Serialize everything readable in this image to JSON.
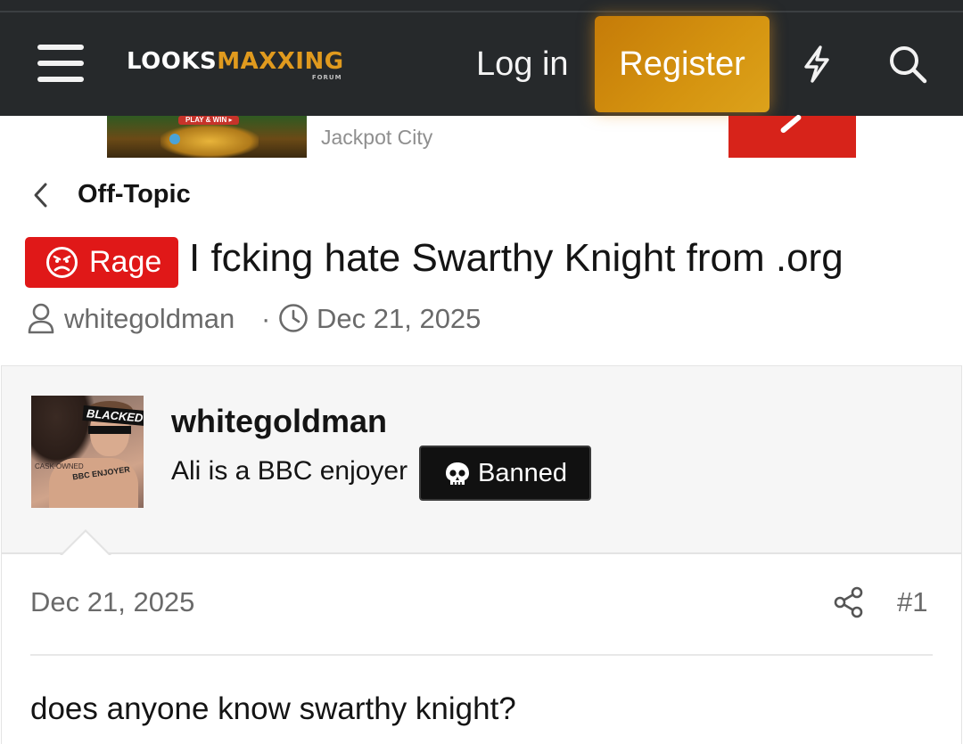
{
  "header": {
    "logo_main_a": "LOOKS",
    "logo_main_b": "MAXXING",
    "logo_sub": "FORUM",
    "login_label": "Log in",
    "register_label": "Register",
    "icons": [
      "menu-icon",
      "bolt-icon",
      "search-icon"
    ],
    "colors": {
      "bar": "#26292b",
      "accent": "#e09a1e",
      "register_bg": "#d08c0c"
    }
  },
  "ad": {
    "image_label": "PLAY & WIN ▸",
    "name": "Jackpot City",
    "button_color": "#d7231a"
  },
  "breadcrumb": {
    "label": "Off-Topic"
  },
  "thread": {
    "prefix_label": "Rage",
    "prefix_color": "#e01818",
    "title": "I fcking hate Swarthy Knight from .org",
    "author": "whitegoldman",
    "separator": "·",
    "date": "Dec 21, 2025"
  },
  "post": {
    "avatar_label": "BLACKED",
    "avatar_tattoo": "BBC ENJOYER",
    "avatar_side_text": "CASK\nOWNED",
    "username": "whitegoldman",
    "user_title": "Ali is a BBC enjoyer",
    "banner_label": "Banned",
    "date": "Dec 21, 2025",
    "number": "#1",
    "body": "does anyone know swarthy knight?"
  }
}
